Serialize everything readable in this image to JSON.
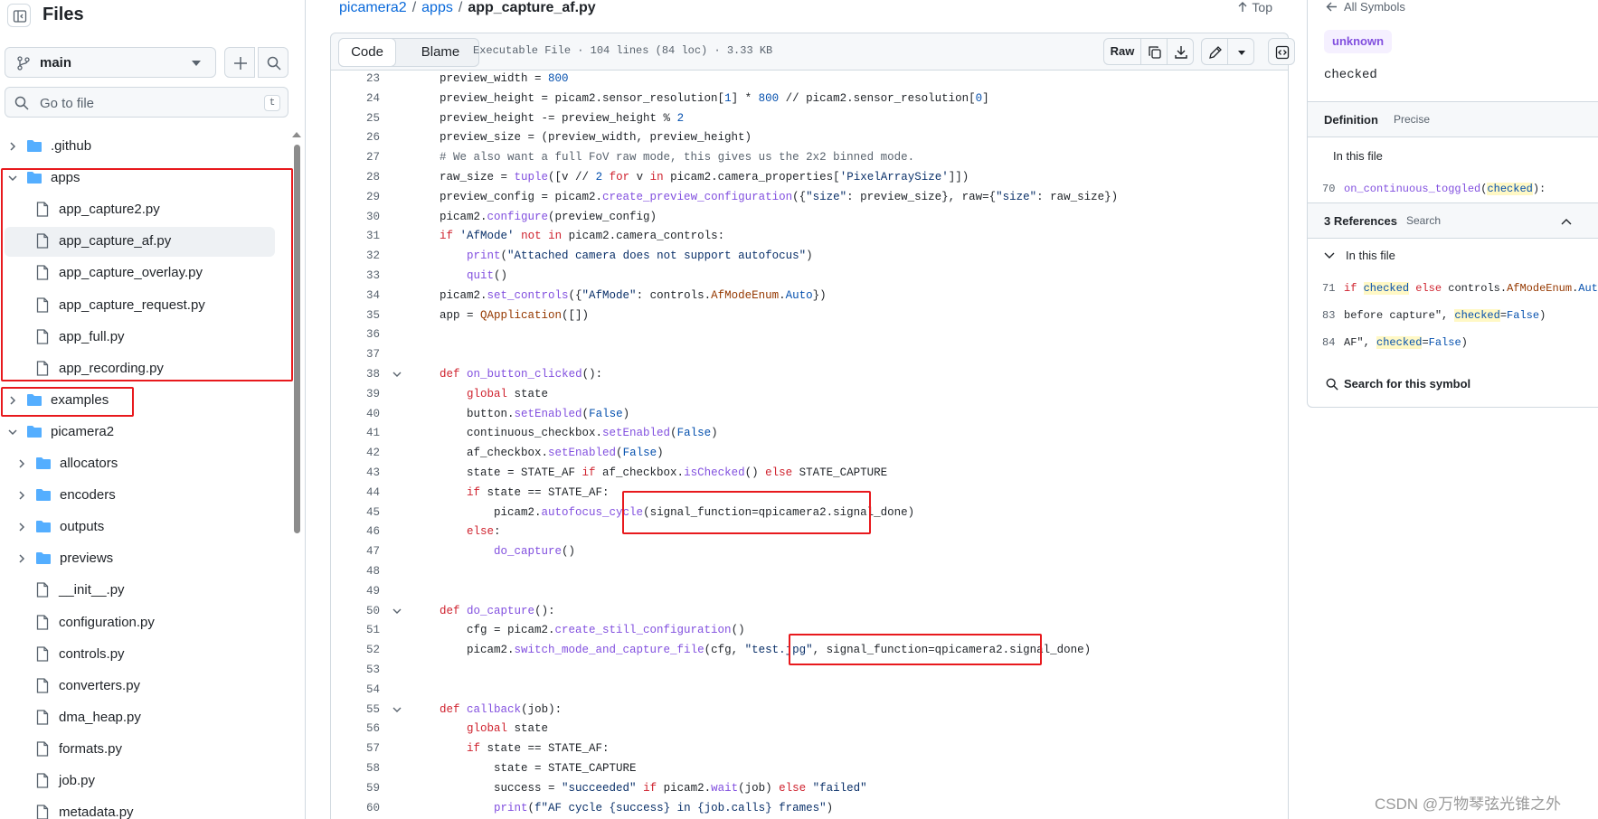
{
  "sidebar": {
    "title": "Files",
    "branch": "main",
    "goto_placeholder": "Go to file",
    "goto_shortcut": "t",
    "tree": [
      {
        "name": ".github",
        "type": "folder",
        "depth": 0,
        "expanded": false
      },
      {
        "name": "apps",
        "type": "folder",
        "depth": 0,
        "expanded": true
      },
      {
        "name": "app_capture2.py",
        "type": "file",
        "depth": 1
      },
      {
        "name": "app_capture_af.py",
        "type": "file",
        "depth": 1,
        "selected": true
      },
      {
        "name": "app_capture_overlay.py",
        "type": "file",
        "depth": 1
      },
      {
        "name": "app_capture_request.py",
        "type": "file",
        "depth": 1
      },
      {
        "name": "app_full.py",
        "type": "file",
        "depth": 1
      },
      {
        "name": "app_recording.py",
        "type": "file",
        "depth": 1
      },
      {
        "name": "examples",
        "type": "folder",
        "depth": 0,
        "expanded": false
      },
      {
        "name": "picamera2",
        "type": "folder",
        "depth": 0,
        "expanded": true
      },
      {
        "name": "allocators",
        "type": "folder",
        "depth": 1,
        "expanded": false
      },
      {
        "name": "encoders",
        "type": "folder",
        "depth": 1,
        "expanded": false
      },
      {
        "name": "outputs",
        "type": "folder",
        "depth": 1,
        "expanded": false
      },
      {
        "name": "previews",
        "type": "folder",
        "depth": 1,
        "expanded": false
      },
      {
        "name": "__init__.py",
        "type": "file",
        "depth": 1
      },
      {
        "name": "configuration.py",
        "type": "file",
        "depth": 1
      },
      {
        "name": "controls.py",
        "type": "file",
        "depth": 1
      },
      {
        "name": "converters.py",
        "type": "file",
        "depth": 1
      },
      {
        "name": "dma_heap.py",
        "type": "file",
        "depth": 1
      },
      {
        "name": "formats.py",
        "type": "file",
        "depth": 1
      },
      {
        "name": "job.py",
        "type": "file",
        "depth": 1
      },
      {
        "name": "metadata.py",
        "type": "file",
        "depth": 1
      }
    ]
  },
  "breadcrumb": {
    "repo": "picamera2",
    "sep": "/",
    "folder": "apps",
    "file": "app_capture_af.py",
    "top": "Top"
  },
  "file_header": {
    "code_tab": "Code",
    "blame_tab": "Blame",
    "info": "Executable File · 104 lines (84 loc) · 3.33 KB",
    "raw": "Raw"
  },
  "code_lines": [
    {
      "n": "23",
      "fold": false,
      "html": "    preview_width = <span class=\"n\">800</span>"
    },
    {
      "n": "24",
      "fold": false,
      "html": "    preview_height = picam2.sensor_resolution[<span class=\"n\">1</span>] * <span class=\"n\">800</span> // picam2.sensor_resolution[<span class=\"n\">0</span>]"
    },
    {
      "n": "25",
      "fold": false,
      "html": "    preview_height -= preview_height % <span class=\"n\">2</span>"
    },
    {
      "n": "26",
      "fold": false,
      "html": "    preview_size = (preview_width, preview_height)"
    },
    {
      "n": "27",
      "fold": false,
      "html": "    <span class=\"c\"># We also want a full FoV raw mode, this gives us the 2x2 binned mode.</span>"
    },
    {
      "n": "28",
      "fold": false,
      "html": "    raw_size = <span class=\"f\">tuple</span>([v // <span class=\"n\">2</span> <span class=\"k\">for</span> v <span class=\"k\">in</span> picam2.camera_properties[<span class=\"s\">'PixelArraySize'</span>]])"
    },
    {
      "n": "29",
      "fold": false,
      "html": "    preview_config = picam2.<span class=\"f\">create_preview_configuration</span>({<span class=\"s\">\"size\"</span>: preview_size}, raw={<span class=\"s\">\"size\"</span>: raw_size})"
    },
    {
      "n": "30",
      "fold": false,
      "html": "    picam2.<span class=\"f\">configure</span>(preview_config)"
    },
    {
      "n": "31",
      "fold": false,
      "html": "    <span class=\"k\">if</span> <span class=\"s\">'AfMode'</span> <span class=\"k\">not in</span> picam2.camera_controls:"
    },
    {
      "n": "32",
      "fold": false,
      "html": "        <span class=\"f\">print</span>(<span class=\"s\">\"Attached camera does not support autofocus\"</span>)"
    },
    {
      "n": "33",
      "fold": false,
      "html": "        <span class=\"f\">quit</span>()"
    },
    {
      "n": "34",
      "fold": false,
      "html": "    picam2.<span class=\"f\">set_controls</span>({<span class=\"s\">\"AfMode\"</span>: controls.<span class=\"cl\">AfModeEnum</span>.<span class=\"n\">Auto</span>})"
    },
    {
      "n": "35",
      "fold": false,
      "html": "    app = <span class=\"cl\">QApplication</span>([])"
    },
    {
      "n": "36",
      "fold": false,
      "html": ""
    },
    {
      "n": "37",
      "fold": false,
      "html": ""
    },
    {
      "n": "38",
      "fold": true,
      "html": "    <span class=\"k\">def</span> <span class=\"f\">on_button_clicked</span>():"
    },
    {
      "n": "39",
      "fold": false,
      "html": "        <span class=\"k\">global</span> state"
    },
    {
      "n": "40",
      "fold": false,
      "html": "        button.<span class=\"f\">setEnabled</span>(<span class=\"n\">False</span>)"
    },
    {
      "n": "41",
      "fold": false,
      "html": "        continuous_checkbox.<span class=\"f\">setEnabled</span>(<span class=\"n\">False</span>)"
    },
    {
      "n": "42",
      "fold": false,
      "html": "        af_checkbox.<span class=\"f\">setEnabled</span>(<span class=\"n\">False</span>)"
    },
    {
      "n": "43",
      "fold": false,
      "html": "        state = STATE_AF <span class=\"k\">if</span> af_checkbox.<span class=\"f\">isChecked</span>() <span class=\"k\">else</span> STATE_CAPTURE"
    },
    {
      "n": "44",
      "fold": false,
      "html": "        <span class=\"k\">if</span> state == STATE_AF:"
    },
    {
      "n": "45",
      "fold": false,
      "html": "            picam2.<span class=\"f\">autofocus_cycle</span>(signal_function=qpicamera2.signal_done)"
    },
    {
      "n": "46",
      "fold": false,
      "html": "        <span class=\"k\">else</span>:"
    },
    {
      "n": "47",
      "fold": false,
      "html": "            <span class=\"f\">do_capture</span>()"
    },
    {
      "n": "48",
      "fold": false,
      "html": ""
    },
    {
      "n": "49",
      "fold": false,
      "html": ""
    },
    {
      "n": "50",
      "fold": true,
      "html": "    <span class=\"k\">def</span> <span class=\"f\">do_capture</span>():"
    },
    {
      "n": "51",
      "fold": false,
      "html": "        cfg = picam2.<span class=\"f\">create_still_configuration</span>()"
    },
    {
      "n": "52",
      "fold": false,
      "html": "        picam2.<span class=\"f\">switch_mode_and_capture_file</span>(cfg, <span class=\"s\">\"test.jpg\"</span>, signal_function=qpicamera2.signal_done)"
    },
    {
      "n": "53",
      "fold": false,
      "html": ""
    },
    {
      "n": "54",
      "fold": false,
      "html": ""
    },
    {
      "n": "55",
      "fold": true,
      "html": "    <span class=\"k\">def</span> <span class=\"f\">callback</span>(job):"
    },
    {
      "n": "56",
      "fold": false,
      "html": "        <span class=\"k\">global</span> state"
    },
    {
      "n": "57",
      "fold": false,
      "html": "        <span class=\"k\">if</span> state == STATE_AF:"
    },
    {
      "n": "58",
      "fold": false,
      "html": "            state = STATE_CAPTURE"
    },
    {
      "n": "59",
      "fold": false,
      "html": "            success = <span class=\"s\">\"succeeded\"</span> <span class=\"k\">if</span> picam2.<span class=\"f\">wait</span>(job) <span class=\"k\">else</span> <span class=\"s\">\"failed\"</span>"
    },
    {
      "n": "60",
      "fold": false,
      "html": "            <span class=\"f\">print</span>(<span class=\"s\">f\"AF cycle {success} in {job.calls} frames\"</span>)"
    }
  ],
  "symbols": {
    "back": "All Symbols",
    "kind": "unknown",
    "name": "checked",
    "definition_title": "Definition",
    "definition_mode": "Precise",
    "in_this_file": "In this file",
    "definition_line": {
      "n": "70",
      "html": "<span class=\"f\">on_continuous_toggled</span>(<span class=\"hl\">checked</span>):"
    },
    "references_title": "3 References",
    "references_search": "Search",
    "refs_in_file": "In this file",
    "references": [
      {
        "n": "71",
        "html": "<span class=\"k\">if</span> <span class=\"hl\">checked</span> <span class=\"k\">else</span> controls.<span class=\"cl\">AfModeEnum</span>.<span class=\"n\">Auto</span>"
      },
      {
        "n": "83",
        "html": "before capture\", <span class=\"hl\">checked</span>=<span class=\"n\">False</span>)"
      },
      {
        "n": "84",
        "html": "AF\", <span class=\"hl\">checked</span>=<span class=\"n\">False</span>)"
      }
    ],
    "search_symbol": "Search for this symbol"
  },
  "watermark": "CSDN @万物琴弦光锥之外",
  "colors": {
    "accent": "#0969da",
    "annotation": "#e8191d",
    "badge": "#8250df"
  }
}
